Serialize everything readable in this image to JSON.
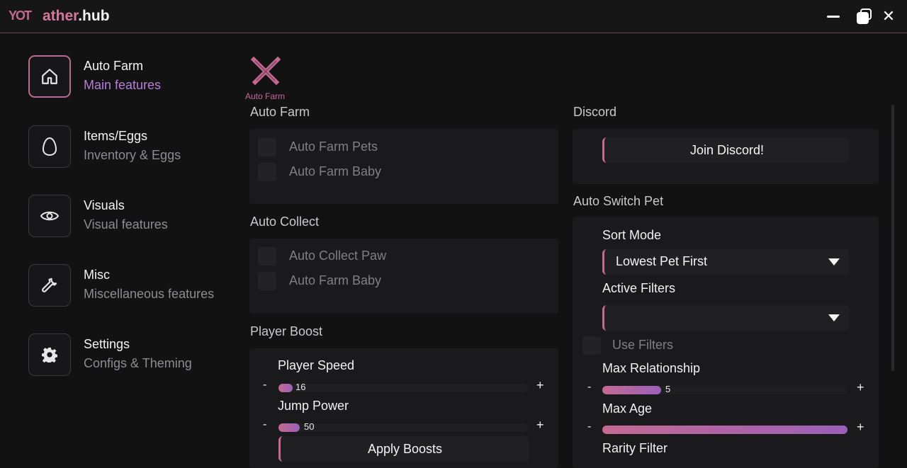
{
  "window": {
    "logo_text": "YOT",
    "title_prefix": "ather",
    "title_suffix": ".hub",
    "minimize_icon": "minimize-icon",
    "maximize_icon": "maximize-icon",
    "close_icon": "close-icon",
    "close_glyph": "✕"
  },
  "sidebar": {
    "items": [
      {
        "title": "Auto Farm",
        "subtitle": "Main features",
        "icon": "home-icon",
        "active": true
      },
      {
        "title": "Items/Eggs",
        "subtitle": "Inventory & Eggs",
        "icon": "egg-icon"
      },
      {
        "title": "Visuals",
        "subtitle": "Visual features",
        "icon": "eye-icon"
      },
      {
        "title": "Misc",
        "subtitle": "Miscellaneous features",
        "icon": "wrench-icon"
      },
      {
        "title": "Settings",
        "subtitle": "Configs & Theming",
        "icon": "gear-icon"
      }
    ]
  },
  "tab": {
    "label": "Auto Farm",
    "icon": "crossed-swords-icon"
  },
  "left": {
    "auto_farm": {
      "title": "Auto Farm",
      "toggles": [
        "Auto Farm Pets",
        "Auto Farm Baby"
      ]
    },
    "auto_collect": {
      "title": "Auto Collect",
      "toggles": [
        "Auto Collect Paw",
        "Auto Farm Baby"
      ]
    },
    "player_boost": {
      "title": "Player Boost",
      "speed_label": "Player Speed",
      "speed_value": "16",
      "speed_fraction": 0.05,
      "jump_label": "Jump Power",
      "jump_value": "50",
      "jump_fraction": 0.08,
      "apply_label": "Apply Boosts",
      "minus": "-",
      "plus": "+"
    }
  },
  "right": {
    "discord": {
      "title": "Discord",
      "button": "Join Discord!"
    },
    "auto_switch": {
      "title": "Auto Switch Pet",
      "sort_mode_label": "Sort Mode",
      "sort_mode_value": "Lowest Pet First",
      "active_filters_label": "Active Filters",
      "active_filters_value": "",
      "use_filters_label": "Use Filters",
      "max_relationship_label": "Max Relationship",
      "max_relationship_value": "5",
      "max_relationship_fraction": 0.24,
      "max_age_label": "Max Age",
      "max_age_fraction": 1.0,
      "rarity_filter_label": "Rarity Filter",
      "minus": "-",
      "plus": "+"
    }
  },
  "colors": {
    "accent": "#c46a92",
    "accent2": "#9b5fb8",
    "background": "#121213",
    "panel": "#1a1a1c"
  }
}
